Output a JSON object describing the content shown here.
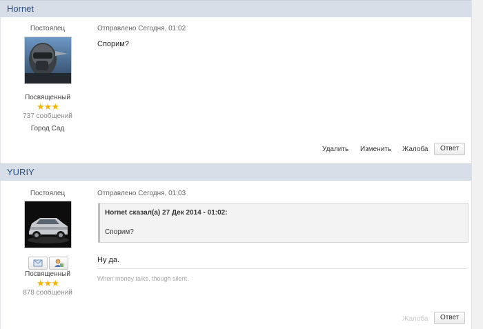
{
  "posts": [
    {
      "author": "Hornet",
      "rank_title": "Постоялец",
      "group": "Посвященный",
      "stars": "★★★",
      "post_count": "737 сообщений",
      "city": "Город Сад",
      "posted": "Отправлено Сегодня, 01:02",
      "text": "Спорим?",
      "actions": {
        "delete": "Удалить",
        "edit": "Изменить",
        "report": "Жалоба",
        "reply": "Ответ"
      }
    },
    {
      "author": "YURIY",
      "rank_title": "Постоялец",
      "group": "Посвященный",
      "stars": "★★★",
      "post_count": "878 сообщений",
      "posted": "Отправлено Сегодня, 01:03",
      "quote": {
        "header": "Hornet сказал(а) 27 Дек 2014 - 01:02:",
        "text": "Спорим?"
      },
      "text": "Ну да.",
      "signature": "When money talks, though silent.",
      "actions": {
        "report": "Жалоба",
        "reply": "Ответ"
      }
    }
  ]
}
